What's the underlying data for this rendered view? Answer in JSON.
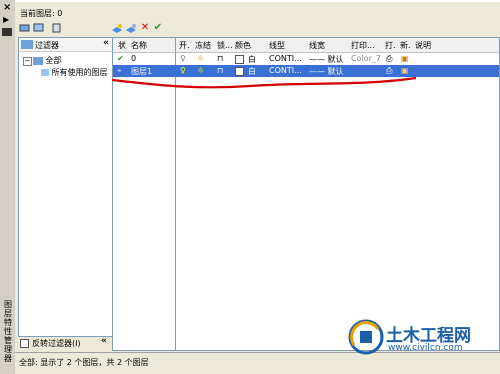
{
  "palette": {
    "vertical_title": "图层特性管理器",
    "current_layer": "当前图层: 0"
  },
  "icons": [
    "new-property-filter-icon",
    "new-group-filter-icon",
    "layer-states-icon",
    "new-layer-icon",
    "new-layer-vp-frozen-icon",
    "delete-layer-icon",
    "set-current-icon"
  ],
  "filter_tree": {
    "header": "过滤器",
    "collapse_glyph": "«",
    "nodes": [
      "全部",
      "所有使用的图层"
    ],
    "invert_label": "反转过滤器(I)"
  },
  "columns": [
    "状",
    "名称",
    "开.",
    "冻结",
    "锁...",
    "颜色",
    "线型",
    "线宽",
    "打印...",
    "打.",
    "新.",
    "说明"
  ],
  "rows": [
    {
      "name": "0",
      "linetype": "",
      "lineweight": "",
      "plotstyle": "Color_7",
      "color": "白",
      "selected": false
    },
    {
      "name": "图层1",
      "linetype": "CONTI...",
      "lineweight": "—— 默认",
      "plotstyle": "Color_7",
      "color": "白",
      "selected": true
    }
  ],
  "row0_linetype": "CONTI...",
  "row0_lineweight": "—— 默认",
  "status": "全部: 显示了 2 个图层，共 2 个图层",
  "watermark": {
    "name": "土木工程网",
    "url": "www.civilcn.com"
  },
  "colors": {
    "selection": "#3a6fd4",
    "annotation": "#d40000",
    "watermark": "#1b5fa8"
  }
}
